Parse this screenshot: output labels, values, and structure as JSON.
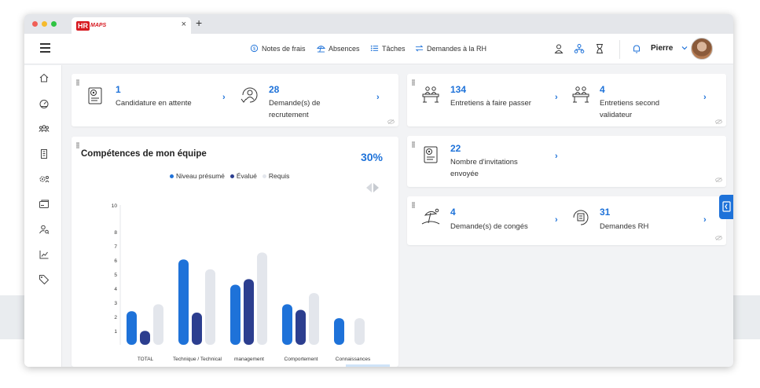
{
  "colors": {
    "accent": "#1e72d9",
    "navy": "#2c3e8f",
    "light": "#e3e6ec"
  },
  "browser": {
    "tab_close": "×",
    "new_tab": "+",
    "logo_hr": "HR",
    "logo_maps": "MAPS"
  },
  "topnav": {
    "menu_icon": "hamburger-icon",
    "links": [
      {
        "label": "Notes de frais",
        "icon": "coins-icon"
      },
      {
        "label": "Absences",
        "icon": "beach-umbrella-icon"
      },
      {
        "label": "Tâches",
        "icon": "checklist-icon"
      },
      {
        "label": "Demandes à la RH",
        "icon": "exchange-icon"
      }
    ],
    "tool_icons": [
      "person-icon",
      "org-chart-icon",
      "hourglass-icon",
      "bell-icon"
    ],
    "user_name": "Pierre"
  },
  "sidebar": {
    "icons": [
      "home-icon",
      "dashboard-icon",
      "team-icon",
      "building-icon",
      "settings-people-icon",
      "card-icon",
      "user-search-icon",
      "analytics-icon",
      "tag-icon"
    ]
  },
  "cards": {
    "recruit": [
      {
        "value": "1",
        "label_lines": [
          "Candidature en attente"
        ]
      },
      {
        "value": "28",
        "label_lines": [
          "Demande(s) de",
          "recrutement"
        ]
      }
    ],
    "interviews": [
      {
        "value": "134",
        "label_lines": [
          "Entretiens à faire passer"
        ]
      },
      {
        "value": "4",
        "label_lines": [
          "Entretiens second",
          "validateur"
        ]
      }
    ],
    "invitations": {
      "value": "22",
      "label_lines": [
        "Nombre d'invitations",
        "envoyée"
      ]
    },
    "leave": [
      {
        "value": "4",
        "label_lines": [
          "Demande(s) de congés"
        ]
      },
      {
        "value": "31",
        "label_lines": [
          "Demandes RH"
        ]
      }
    ]
  },
  "chart_panel": {
    "title": "Compétences de mon équipe",
    "percent": "30%"
  },
  "chart_data": {
    "type": "bar",
    "title": "Compétences de mon équipe",
    "categories": [
      "TOTAL",
      "Technique / Technical",
      "management",
      "Comportement",
      "Connaissances"
    ],
    "series": [
      {
        "name": "Niveau présumé",
        "color": "#1e72d9",
        "values": [
          2.4,
          6.1,
          4.3,
          2.9,
          1.9
        ]
      },
      {
        "name": "Évalué",
        "color": "#2c3e8f",
        "values": [
          1.0,
          2.3,
          4.7,
          2.5,
          null
        ]
      },
      {
        "name": "Requis",
        "color": "#e3e6ec",
        "values": [
          2.9,
          5.4,
          6.6,
          3.7,
          1.9
        ]
      }
    ],
    "yticks": [
      "10",
      "8",
      "7",
      "6",
      "5",
      "4",
      "3",
      "2",
      "1"
    ],
    "ylim": [
      0,
      10
    ],
    "grid": false,
    "legend": "top"
  }
}
